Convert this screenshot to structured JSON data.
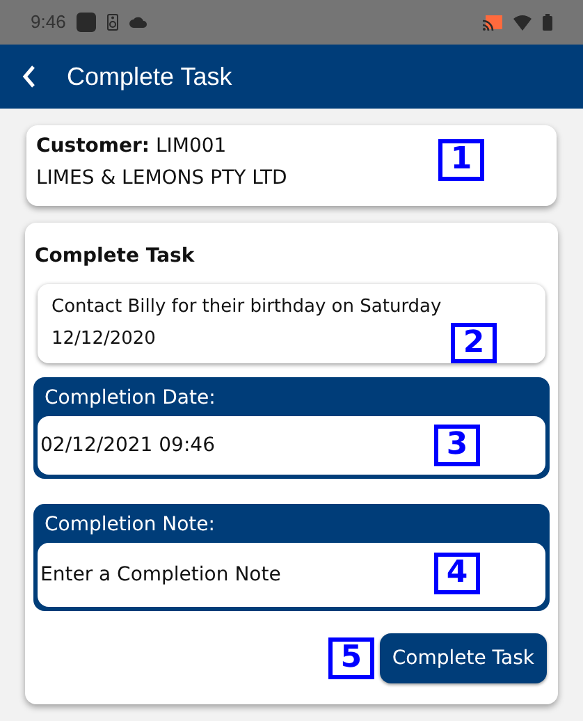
{
  "status_bar": {
    "time": "9:46"
  },
  "app_bar": {
    "title": "Complete Task"
  },
  "customer": {
    "label": "Customer:",
    "code": "LIM001",
    "name": "LIMES & LEMONS PTY LTD",
    "callout": "1"
  },
  "task": {
    "heading": "Complete Task",
    "description": "Contact Billy for their birthday on Saturday 12/12/2020",
    "callout": "2"
  },
  "completion_date": {
    "label": "Completion Date:",
    "value": "02/12/2021 09:46",
    "callout": "3"
  },
  "completion_note": {
    "label": "Completion Note:",
    "placeholder": "Enter a Completion Note",
    "callout": "4"
  },
  "submit": {
    "label": "Complete Task",
    "callout": "5"
  }
}
